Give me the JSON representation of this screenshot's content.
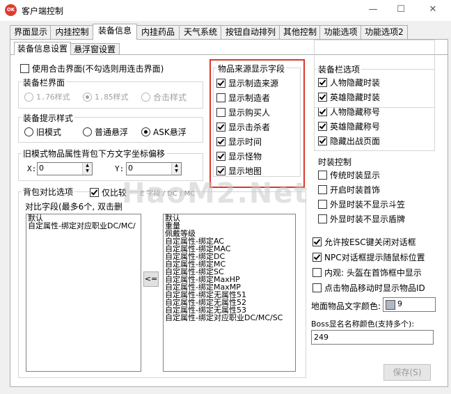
{
  "window": {
    "title": "客户端控制",
    "icon_text": "OK",
    "minimize": "—",
    "maximize": "☐",
    "close": "✕"
  },
  "tabs": [
    "界面显示",
    "内挂控制",
    "装备信息",
    "内挂药品",
    "天气系统",
    "按钮自动排列",
    "其他控制",
    "功能选项",
    "功能选项2"
  ],
  "active_tab": "装备信息",
  "subtabs": [
    "装备信息设置",
    "悬浮窗设置"
  ],
  "active_subtab": "装备信息设置",
  "top_checkbox": {
    "label": "使用合击界面(不勾选则用连击界面)",
    "checked": false
  },
  "equip_ui": {
    "title": "装备栏界面",
    "options": [
      "1.76样式",
      "1.85样式",
      "合击样式"
    ],
    "selected": "1.85样式"
  },
  "tooltip_style": {
    "title": "装备提示样式",
    "options": [
      "旧模式",
      "普通悬浮",
      "ASK悬浮"
    ],
    "selected": "ASK悬浮"
  },
  "offset": {
    "title": "旧模式物品属性背包下方文字坐标偏移",
    "x_label": "X:",
    "x_value": "0",
    "y_label": "Y:",
    "y_value": "0"
  },
  "bag_compare": {
    "title": "背包对比选项",
    "only_compare_label": "仅比较",
    "fields_label": "对比字段(最多6个, 双击删",
    "left_list": [
      "默认",
      "自定属性-绑定对应职业DC/MC/"
    ],
    "right_list": [
      "默认",
      "重量",
      "佩戴等级",
      "自定属性-绑定AC",
      "自定属性-绑定MAC",
      "自定属性-绑定DC",
      "自定属性-绑定MC",
      "自定属性-绑定SC",
      "自定属性-绑定MaxHP",
      "自定属性-绑定MaxMP",
      "自定属性-绑定无属性51",
      "自定属性-绑定无属性52",
      "自定属性-绑定无属性53",
      "自定属性-绑定对应职业DC/MC/SC"
    ],
    "move_button": "<=",
    "header_fragment": "E 字段 / DC / MC"
  },
  "source_fields": {
    "title": "物品来源显示字段",
    "items": [
      {
        "label": "显示制造来源",
        "checked": true
      },
      {
        "label": "显示制造者",
        "checked": false
      },
      {
        "label": "显示购买人",
        "checked": false
      },
      {
        "label": "显示击杀者",
        "checked": true
      },
      {
        "label": "显示时间",
        "checked": true
      },
      {
        "label": "显示怪物",
        "checked": true
      },
      {
        "label": "显示地图",
        "checked": true
      }
    ],
    "highlight_color": "#d9362b"
  },
  "equip_options": {
    "title": "装备栏选项",
    "items": [
      {
        "label": "人物隐藏时装",
        "checked": true
      },
      {
        "label": "英雄隐藏时装",
        "checked": true
      },
      {
        "label": "人物隐藏称号",
        "checked": true
      },
      {
        "label": "英雄隐藏称号",
        "checked": true
      },
      {
        "label": "隐藏出战页面",
        "checked": true
      }
    ]
  },
  "fashion": {
    "title": "时装控制",
    "items": [
      {
        "label": "传统时装显示",
        "checked": false
      },
      {
        "label": "开启时装首饰",
        "checked": false
      },
      {
        "label": "外显时装不显示斗笠",
        "checked": false
      },
      {
        "label": "外显时装不显示盾牌",
        "checked": false
      }
    ]
  },
  "misc_options": [
    {
      "label": "允许按ESC键关闭对话框",
      "checked": true
    },
    {
      "label": "NPC对话框提示随鼠标位置",
      "checked": true
    },
    {
      "label": "内观: 头盔在首饰框中显示",
      "checked": false
    },
    {
      "label": "点击物品移动时显示物品ID",
      "checked": false
    }
  ],
  "ground_color": {
    "label": "地面物品文字颜色:",
    "value": "9"
  },
  "boss_color": {
    "label": "Boss显名名称颜色(支持多个):",
    "value": "249"
  },
  "save_button": "保存(S)",
  "watermark": "HaoM2.Net"
}
